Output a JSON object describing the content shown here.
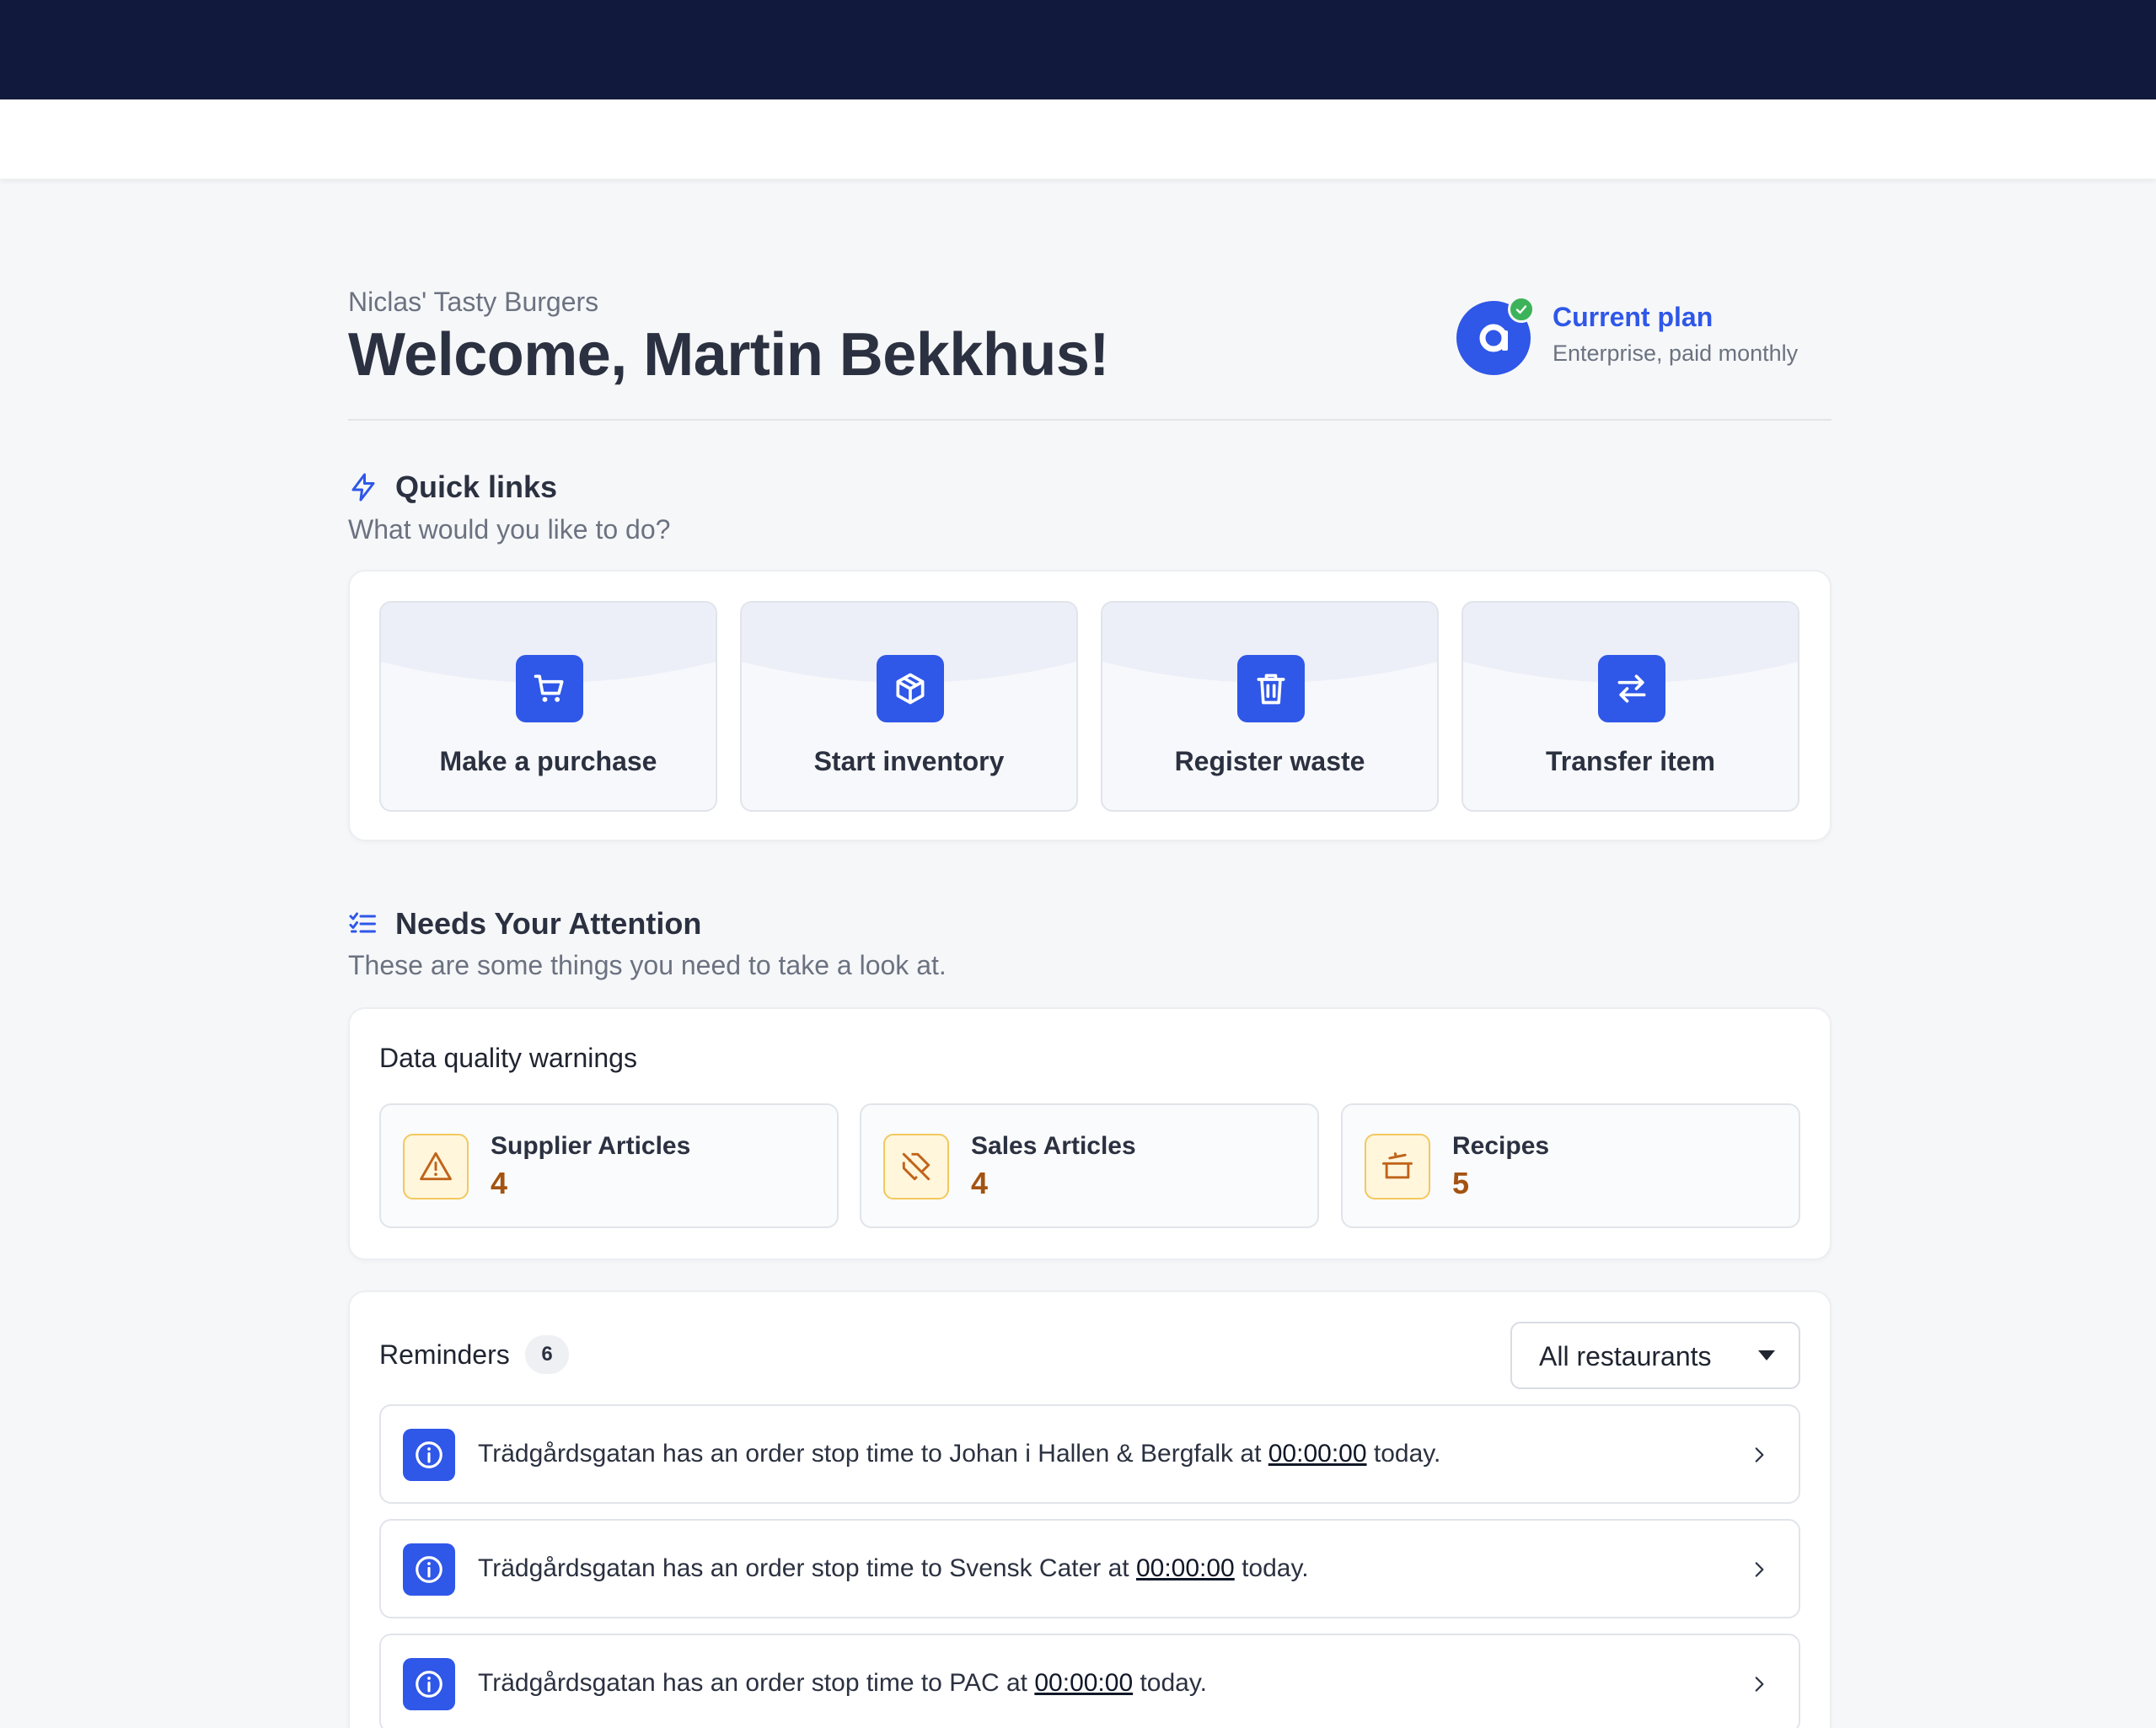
{
  "header": {
    "restaurant_name": "Niclas' Tasty Burgers",
    "welcome": "Welcome, Martin Bekkhus!"
  },
  "plan": {
    "title": "Current plan",
    "subtitle": "Enterprise, paid monthly",
    "avatar_icon": "app-logo-icon",
    "status_icon": "check-icon"
  },
  "quick_links": {
    "title": "Quick links",
    "subtitle": "What would you like to do?",
    "icon": "lightning-icon",
    "items": [
      {
        "label": "Make a purchase",
        "icon": "cart-icon"
      },
      {
        "label": "Start inventory",
        "icon": "box-icon"
      },
      {
        "label": "Register waste",
        "icon": "trash-icon"
      },
      {
        "label": "Transfer item",
        "icon": "transfer-icon"
      }
    ]
  },
  "attention": {
    "title": "Needs Your Attention",
    "subtitle": "These are some things you need to take a look at.",
    "icon": "checklist-icon"
  },
  "data_quality": {
    "title": "Data quality warnings",
    "items": [
      {
        "label": "Supplier Articles",
        "count": "4",
        "icon": "warning-icon"
      },
      {
        "label": "Sales Articles",
        "count": "4",
        "icon": "no-tag-icon"
      },
      {
        "label": "Recipes",
        "count": "5",
        "icon": "pot-icon"
      }
    ]
  },
  "reminders": {
    "title": "Reminders",
    "count": "6",
    "filter": "All restaurants",
    "items": [
      {
        "before": "Trädgårdsgatan has an order stop time to Johan i Hallen & Bergfalk at ",
        "time": "00:00:00",
        "after": " today."
      },
      {
        "before": "Trädgårdsgatan has an order stop time to Svensk Cater at ",
        "time": "00:00:00",
        "after": " today."
      },
      {
        "before": "Trädgårdsgatan has an order stop time to PAC at ",
        "time": "00:00:00",
        "after": " today."
      }
    ]
  },
  "colors": {
    "topbar": "#111a3d",
    "accent": "#2f57e8",
    "warning_count": "#a35412",
    "warning_bg": "#fff6dc"
  }
}
